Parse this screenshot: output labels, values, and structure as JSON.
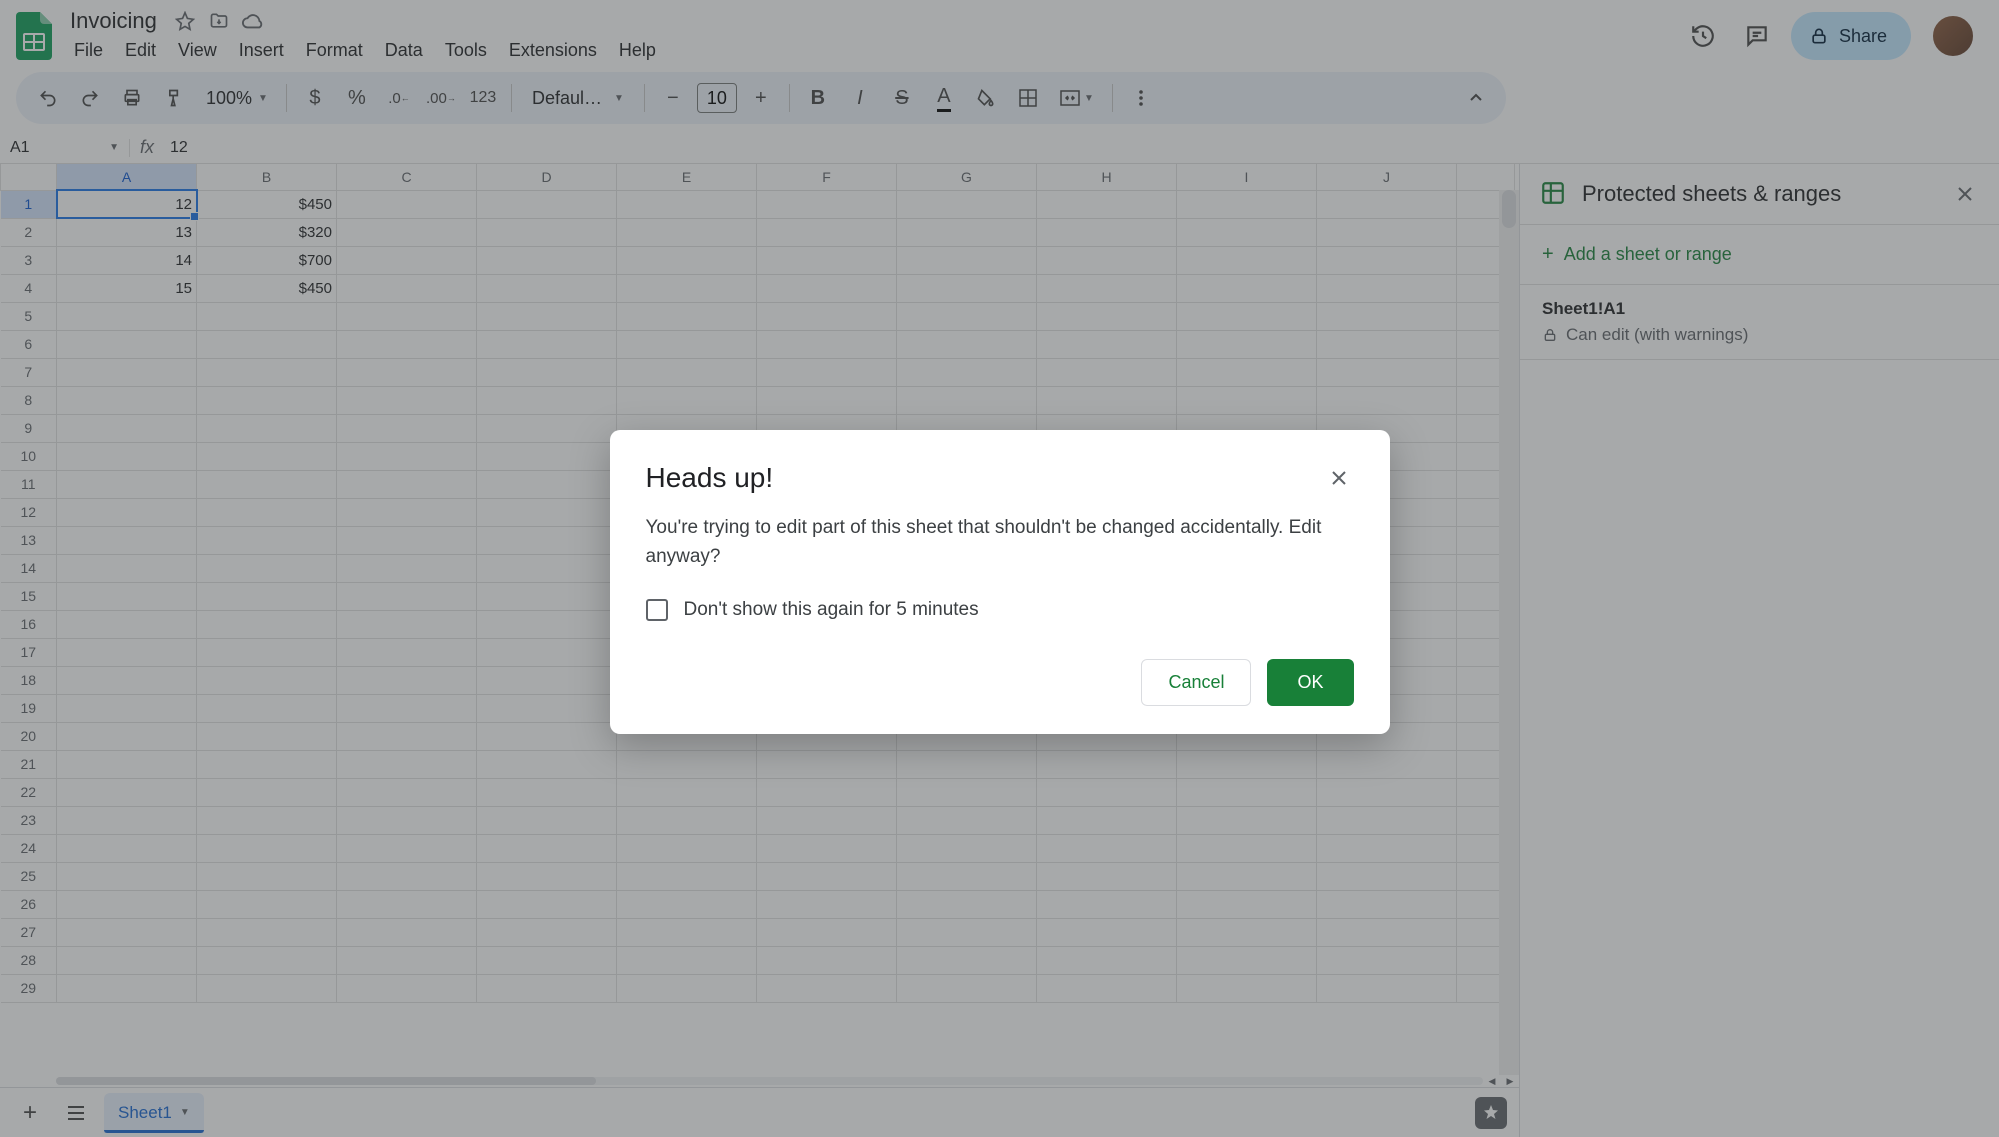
{
  "doc": {
    "title": "Invoicing"
  },
  "menu": [
    "File",
    "Edit",
    "View",
    "Insert",
    "Format",
    "Data",
    "Tools",
    "Extensions",
    "Help"
  ],
  "toolbar": {
    "zoom": "100%",
    "fmt123": "123",
    "font": "Defaul…",
    "fontSize": "10"
  },
  "share": "Share",
  "namebox": "A1",
  "formula": "12",
  "columns": [
    "A",
    "B",
    "C",
    "D",
    "E",
    "F",
    "G",
    "H",
    "I",
    "J"
  ],
  "rowCount": 29,
  "cells": {
    "A1": "12",
    "B1": "$450",
    "A2": "13",
    "B2": "$320",
    "A3": "14",
    "B3": "$700",
    "A4": "15",
    "B4": "$450"
  },
  "selected": {
    "cell": "A1",
    "col": "A",
    "row": 1
  },
  "sheet": {
    "active": "Sheet1"
  },
  "sidepanel": {
    "title": "Protected sheets & ranges",
    "add": "Add a sheet or range",
    "item_range": "Sheet1!A1",
    "item_perm": "Can edit (with warnings)"
  },
  "dialog": {
    "title": "Heads up!",
    "body": "You're trying to edit part of this sheet that shouldn't be changed accidentally. Edit anyway?",
    "checkbox": "Don't show this again for 5 minutes",
    "cancel": "Cancel",
    "ok": "OK"
  }
}
